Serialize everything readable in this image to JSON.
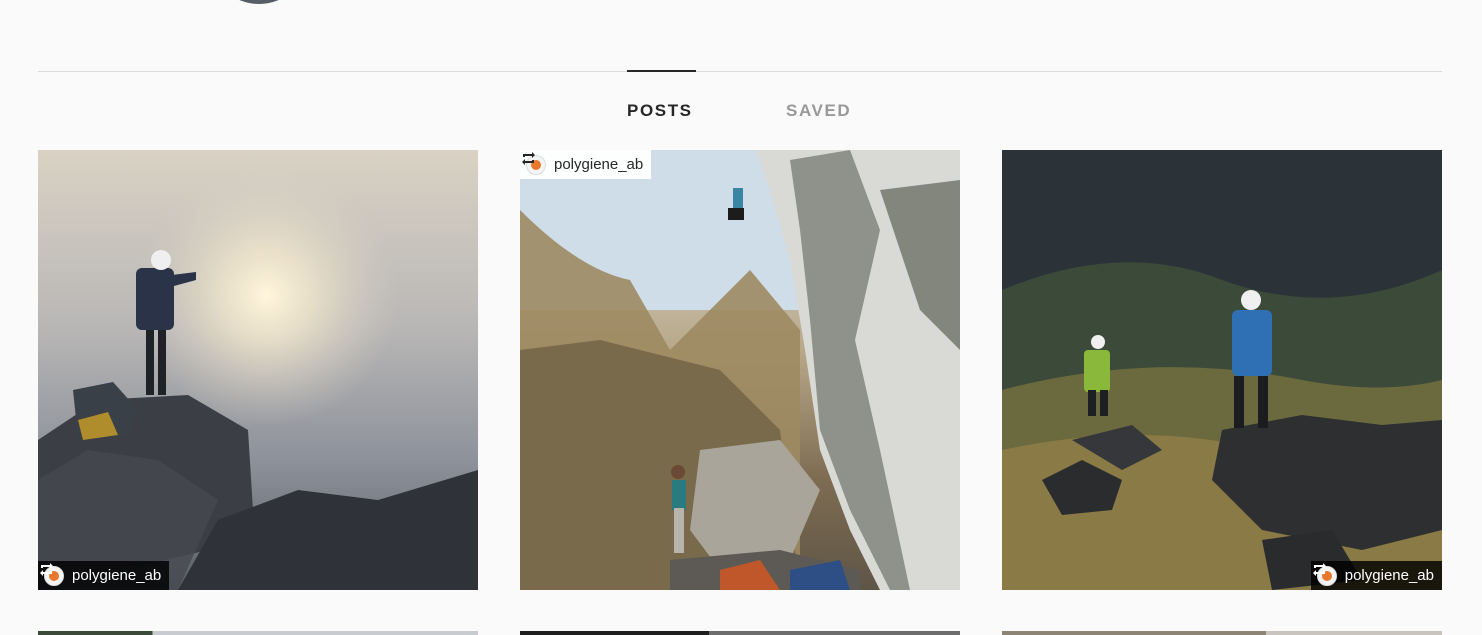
{
  "profile": {
    "avatar_icon": "profile-avatar"
  },
  "tabs": [
    {
      "label": "POSTS",
      "active": true
    },
    {
      "label": "SAVED",
      "active": false
    }
  ],
  "posts": [
    {
      "repost_icon": "repost-icon",
      "account": "polygiene_ab",
      "badge_theme": "dark"
    },
    {
      "repost_icon": "repost-icon",
      "account": "polygiene_ab",
      "badge_theme": "light"
    },
    {
      "repost_icon": "repost-icon",
      "account": "polygiene_ab",
      "badge_theme": "dark"
    }
  ],
  "colors": {
    "background": "#fafafa",
    "active_tab": "#262626",
    "inactive_tab": "#999999",
    "divider": "#dbdbdb",
    "brand_accent": "#e8782c"
  }
}
